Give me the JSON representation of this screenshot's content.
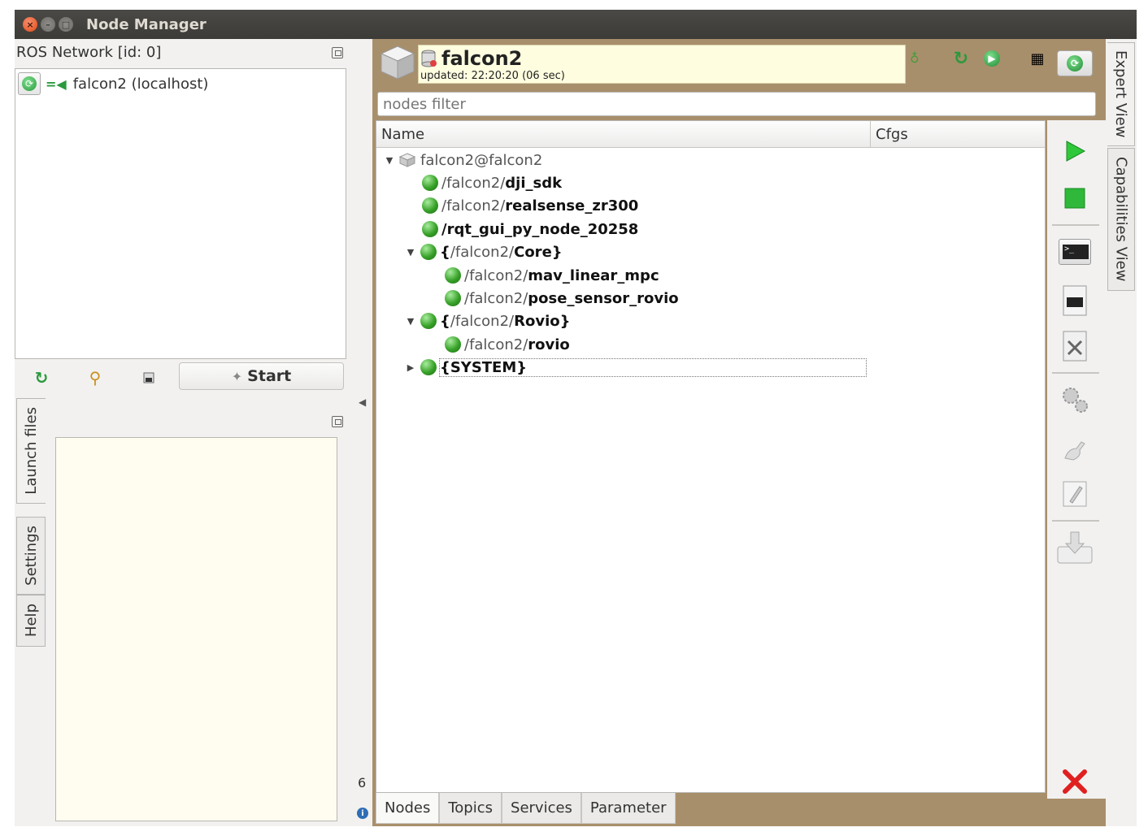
{
  "window": {
    "title": "Node Manager"
  },
  "ros_network": {
    "title": "ROS Network [id: 0]",
    "hosts": [
      {
        "label": "falcon2 (localhost)"
      }
    ]
  },
  "left_toolbar": {
    "start_label": "Start"
  },
  "left_tabs": [
    "Launch files",
    "Settings",
    "Help"
  ],
  "status": {
    "count": "6"
  },
  "host_header": {
    "name": "falcon2",
    "updated": "updated: 22:20:20 (06 sec)"
  },
  "filter": {
    "placeholder": "nodes filter"
  },
  "tree": {
    "columns": [
      "Name",
      "Cfgs"
    ],
    "root": {
      "label": "falcon2@falcon2"
    },
    "rows": [
      {
        "ns": "/falcon2/",
        "name": "dji_sdk"
      },
      {
        "ns": "/falcon2/",
        "name": "realsense_zr300"
      },
      {
        "ns": "/",
        "name": "rqt_gui_py_node_20258"
      },
      {
        "prefix": "{",
        "ns": "/falcon2/",
        "name": "Core",
        "suffix": "}"
      },
      {
        "ns": "/falcon2/",
        "name": "mav_linear_mpc"
      },
      {
        "ns": "/falcon2/",
        "name": "pose_sensor_rovio"
      },
      {
        "prefix": "{",
        "ns": "/falcon2/",
        "name": "Rovio",
        "suffix": "}"
      },
      {
        "ns": "/falcon2/",
        "name": "rovio"
      },
      {
        "name": "{SYSTEM}"
      }
    ]
  },
  "bottom_tabs": [
    "Nodes",
    "Topics",
    "Services",
    "Parameter"
  ],
  "right_tabs": [
    "Expert View",
    "Capabilities View"
  ],
  "icons": {
    "accent_green": "#2a9a3c",
    "close_red": "#e02020"
  }
}
